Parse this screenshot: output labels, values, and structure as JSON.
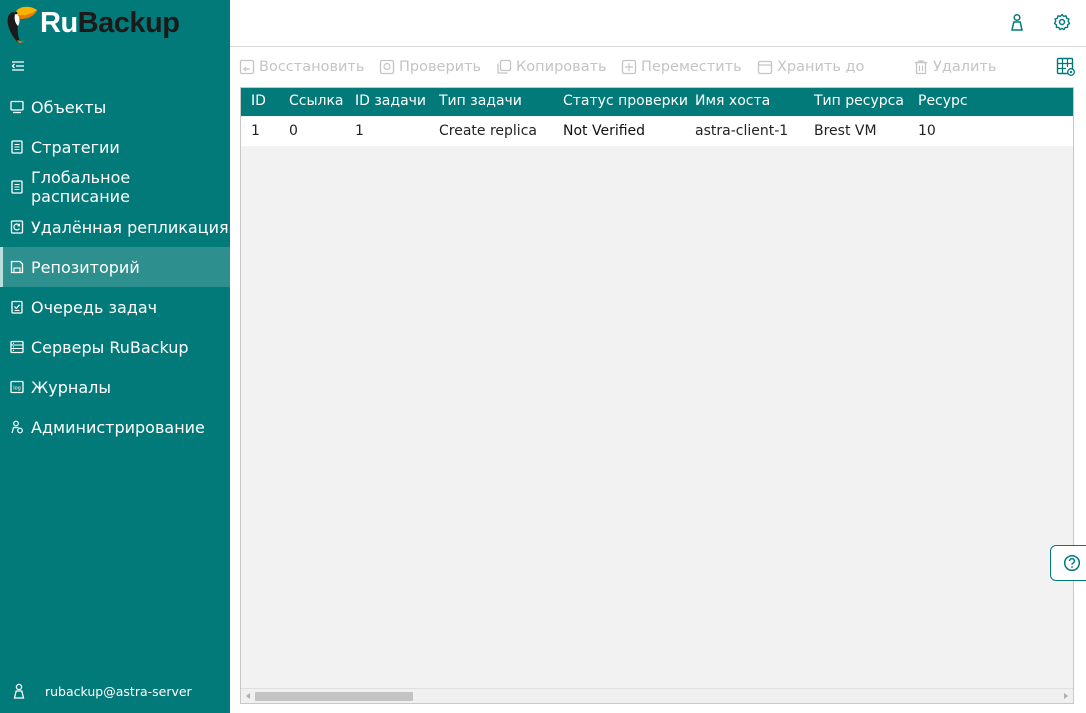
{
  "app": {
    "logo_ru": "Ru",
    "logo_backup": "Backup",
    "colors": {
      "sidebar": "#037a7a",
      "active_item": "#2e8f8f",
      "accent": "#037a7a",
      "disabled": "#c4c4c4"
    }
  },
  "sidebar": {
    "items": [
      {
        "label": "Объекты",
        "icon": "monitor-icon"
      },
      {
        "label": "Стратегии",
        "icon": "document-icon"
      },
      {
        "label": "Глобальное расписание",
        "icon": "document-icon"
      },
      {
        "label": "Удалённая репликация",
        "icon": "replication-icon"
      },
      {
        "label": "Репозиторий",
        "icon": "storage-icon",
        "active": true
      },
      {
        "label": "Очередь задач",
        "icon": "checklist-icon"
      },
      {
        "label": "Серверы RuBackup",
        "icon": "server-icon"
      },
      {
        "label": "Журналы",
        "icon": "log-icon"
      },
      {
        "label": "Администрирование",
        "icon": "admin-icon"
      }
    ],
    "user": "rubackup@astra-server"
  },
  "toolbar": {
    "restore": "Восстановить",
    "verify": "Проверить",
    "copy": "Копировать",
    "move": "Переместить",
    "keep_until": "Хранить до",
    "delete": "Удалить"
  },
  "table": {
    "columns": [
      "ID",
      "Ссылка",
      "ID задачи",
      "Тип задачи",
      "Статус проверки",
      "Имя хоста",
      "Тип ресурса",
      "Ресурс"
    ],
    "rows": [
      [
        "1",
        "0",
        "1",
        "Create replica",
        "Not Verified",
        "astra-client-1",
        "Brest VM",
        "10"
      ]
    ]
  }
}
